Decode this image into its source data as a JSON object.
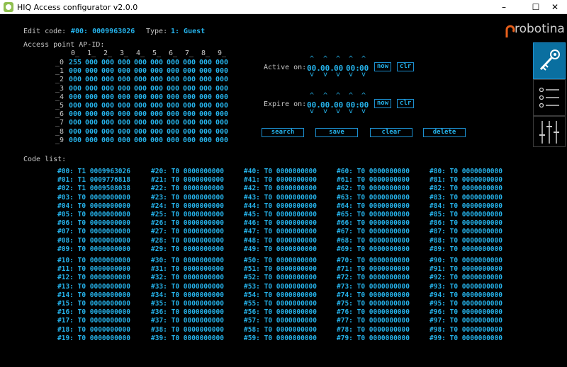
{
  "window": {
    "title": "HIQ Access configurator v2.0.0",
    "minimize": "–",
    "maximize": "☐",
    "close": "✕"
  },
  "logo": {
    "text": "robotina"
  },
  "edit": {
    "label": "Edit code:",
    "value": "#00: 0009963026",
    "type_label": "Type:",
    "type_value": "1: Guest"
  },
  "access_point": {
    "label": "Access point AP-ID:",
    "headers": [
      "0_",
      "1_",
      "2_",
      "3_",
      "4_",
      "5_",
      "6_",
      "7_",
      "8_",
      "9_"
    ],
    "row_labels": [
      "_0",
      "_1",
      "_2",
      "_3",
      "_4",
      "_5",
      "_6",
      "_7",
      "_8",
      "_9"
    ],
    "rows": [
      [
        "255",
        "000",
        "000",
        "000",
        "000",
        "000",
        "000",
        "000",
        "000",
        "000"
      ],
      [
        "000",
        "000",
        "000",
        "000",
        "000",
        "000",
        "000",
        "000",
        "000",
        "000"
      ],
      [
        "000",
        "000",
        "000",
        "000",
        "000",
        "000",
        "000",
        "000",
        "000",
        "000"
      ],
      [
        "000",
        "000",
        "000",
        "000",
        "000",
        "000",
        "000",
        "000",
        "000",
        "000"
      ],
      [
        "000",
        "000",
        "000",
        "000",
        "000",
        "000",
        "000",
        "000",
        "000",
        "000"
      ],
      [
        "000",
        "000",
        "000",
        "000",
        "000",
        "000",
        "000",
        "000",
        "000",
        "000"
      ],
      [
        "000",
        "000",
        "000",
        "000",
        "000",
        "000",
        "000",
        "000",
        "000",
        "000"
      ],
      [
        "000",
        "000",
        "000",
        "000",
        "000",
        "000",
        "000",
        "000",
        "000",
        "000"
      ],
      [
        "000",
        "000",
        "000",
        "000",
        "000",
        "000",
        "000",
        "000",
        "000",
        "000"
      ],
      [
        "000",
        "000",
        "000",
        "000",
        "000",
        "000",
        "000",
        "000",
        "000",
        "000"
      ]
    ]
  },
  "active_on": {
    "label": "Active on:",
    "values": [
      "00.",
      "00.",
      "00",
      "00:",
      "00"
    ]
  },
  "expire_on": {
    "label": "Expire on:",
    "values": [
      "00.",
      "00.",
      "00",
      "00:",
      "00"
    ]
  },
  "time_buttons": {
    "now": "now",
    "clr": "clr"
  },
  "arrows": {
    "up": "^",
    "down": "v"
  },
  "actions": {
    "search": "search",
    "save": "save",
    "clear": "clear",
    "delete": "delete"
  },
  "code_list": {
    "label": "Code list:",
    "items": [
      "#00: T1 0009963026",
      "#01: T1 0009776818",
      "#02: T1 0009508038",
      "#03: T0 0000000000",
      "#04: T0 0000000000",
      "#05: T0 0000000000",
      "#06: T0 0000000000",
      "#07: T0 0000000000",
      "#08: T0 0000000000",
      "#09: T0 0000000000",
      "#10: T0 0000000000",
      "#11: T0 0000000000",
      "#12: T0 0000000000",
      "#13: T0 0000000000",
      "#14: T0 0000000000",
      "#15: T0 0000000000",
      "#16: T0 0000000000",
      "#17: T0 0000000000",
      "#18: T0 0000000000",
      "#19: T0 0000000000",
      "#20: T0 0000000000",
      "#21: T0 0000000000",
      "#22: T0 0000000000",
      "#23: T0 0000000000",
      "#24: T0 0000000000",
      "#25: T0 0000000000",
      "#26: T0 0000000000",
      "#27: T0 0000000000",
      "#28: T0 0000000000",
      "#29: T0 0000000000",
      "#30: T0 0000000000",
      "#31: T0 0000000000",
      "#32: T0 0000000000",
      "#33: T0 0000000000",
      "#34: T0 0000000000",
      "#35: T0 0000000000",
      "#36: T0 0000000000",
      "#37: T0 0000000000",
      "#38: T0 0000000000",
      "#39: T0 0000000000",
      "#40: T0 0000000000",
      "#41: T0 0000000000",
      "#42: T0 0000000000",
      "#43: T0 0000000000",
      "#44: T0 0000000000",
      "#45: T0 0000000000",
      "#46: T0 0000000000",
      "#47: T0 0000000000",
      "#48: T0 0000000000",
      "#49: T0 0000000000",
      "#50: T0 0000000000",
      "#51: T0 0000000000",
      "#52: T0 0000000000",
      "#53: T0 0000000000",
      "#54: T0 0000000000",
      "#55: T0 0000000000",
      "#56: T0 0000000000",
      "#57: T0 0000000000",
      "#58: T0 0000000000",
      "#59: T0 0000000000",
      "#60: T0 0000000000",
      "#61: T0 0000000000",
      "#62: T0 0000000000",
      "#63: T0 0000000000",
      "#64: T0 0000000000",
      "#65: T0 0000000000",
      "#66: T0 0000000000",
      "#67: T0 0000000000",
      "#68: T0 0000000000",
      "#69: T0 0000000000",
      "#70: T0 0000000000",
      "#71: T0 0000000000",
      "#72: T0 0000000000",
      "#73: T0 0000000000",
      "#74: T0 0000000000",
      "#75: T0 0000000000",
      "#76: T0 0000000000",
      "#77: T0 0000000000",
      "#78: T0 0000000000",
      "#79: T0 0000000000",
      "#80: T0 0000000000",
      "#81: T0 0000000000",
      "#82: T0 0000000000",
      "#83: T0 0000000000",
      "#84: T0 0000000000",
      "#85: T0 0000000000",
      "#86: T0 0000000000",
      "#87: T0 0000000000",
      "#88: T0 0000000000",
      "#89: T0 0000000000",
      "#90: T0 0000000000",
      "#91: T0 0000000000",
      "#92: T0 0000000000",
      "#93: T0 0000000000",
      "#94: T0 0000000000",
      "#95: T0 0000000000",
      "#96: T0 0000000000",
      "#97: T0 0000000000",
      "#98: T0 0000000000",
      "#99: T0 0000000000"
    ]
  },
  "side_panels": [
    {
      "icon": "key-icon",
      "active": true
    },
    {
      "icon": "list-icon",
      "active": false
    },
    {
      "icon": "sliders-icon",
      "active": false
    }
  ],
  "colors": {
    "accent": "#25b2ea",
    "label": "#c8c8c8",
    "background": "#000000",
    "logo_orange": "#e8601c"
  }
}
